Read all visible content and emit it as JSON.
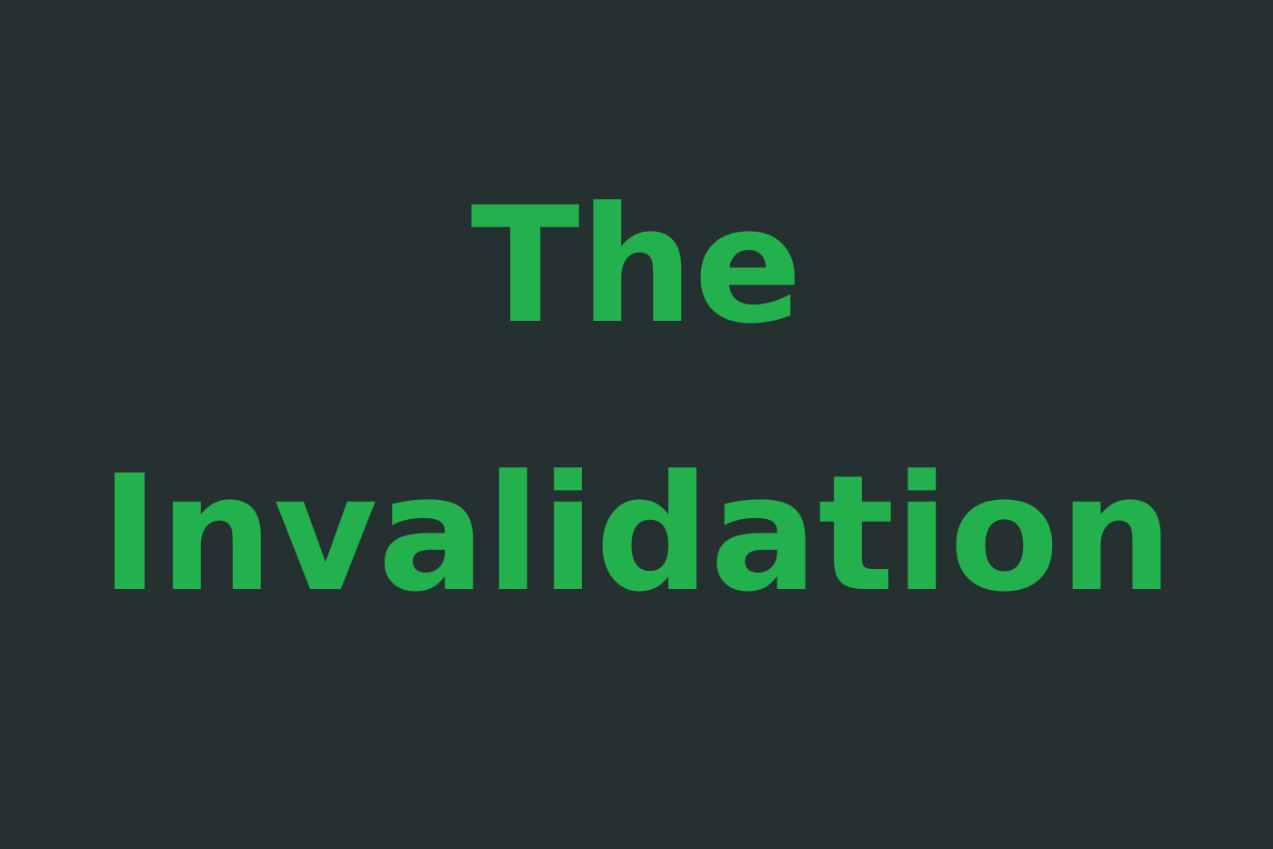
{
  "title": {
    "line1": "The",
    "line2": "Invalidation"
  },
  "colors": {
    "background": "#253031",
    "text": "#23b14d"
  }
}
